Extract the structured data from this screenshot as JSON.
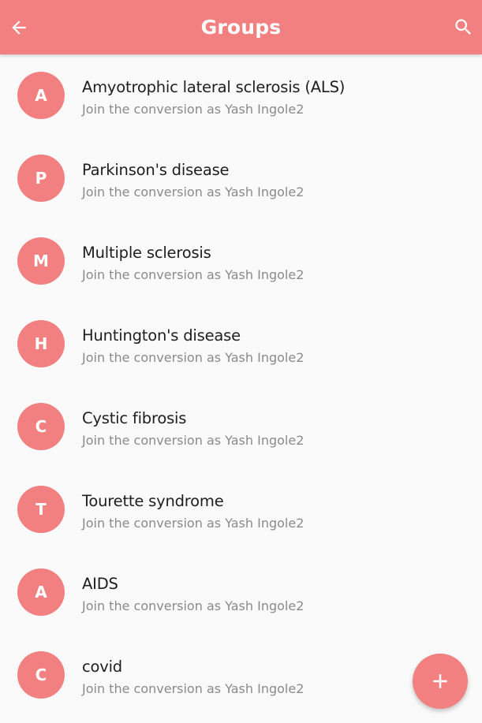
{
  "header": {
    "title": "Groups",
    "back_icon": "arrow-left-icon",
    "search_icon": "search-icon",
    "background_color": "#f28080"
  },
  "groups": [
    {
      "initial": "A",
      "name": "Amyotrophic lateral sclerosis (ALS)",
      "subtitle": "Join the conversion as Yash Ingole2"
    },
    {
      "initial": "P",
      "name": "Parkinson's disease",
      "subtitle": "Join the conversion as Yash Ingole2"
    },
    {
      "initial": "M",
      "name": "Multiple sclerosis",
      "subtitle": "Join the conversion as Yash Ingole2"
    },
    {
      "initial": "H",
      "name": "Huntington's disease",
      "subtitle": "Join the conversion as Yash Ingole2"
    },
    {
      "initial": "C",
      "name": "Cystic fibrosis",
      "subtitle": "Join the conversion as Yash Ingole2"
    },
    {
      "initial": "T",
      "name": "Tourette syndrome",
      "subtitle": "Join the conversion as Yash Ingole2"
    },
    {
      "initial": "A",
      "name": "AIDS",
      "subtitle": "Join the conversion as Yash Ingole2"
    },
    {
      "initial": "C",
      "name": "covid",
      "subtitle": "Join the conversion as Yash Ingole2"
    }
  ],
  "fab": {
    "icon": "plus-icon"
  },
  "colors": {
    "accent": "#f28080",
    "title_text": "#1e1e1e",
    "subtitle_text": "#8a8a8a",
    "background": "#fafafa"
  }
}
